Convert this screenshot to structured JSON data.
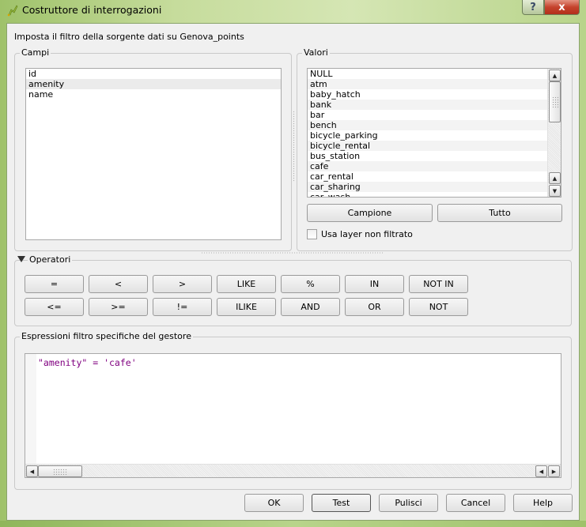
{
  "window": {
    "title": "Costruttore di interrogazioni",
    "help_button": "?",
    "close_button": "x"
  },
  "subtitle": "Imposta il filtro della sorgente dati su Genova_points",
  "campi": {
    "label": "Campi",
    "items": [
      "id",
      "amenity",
      "name"
    ],
    "selected": "amenity"
  },
  "valori": {
    "label": "Valori",
    "items": [
      "NULL",
      "atm",
      "baby_hatch",
      "bank",
      "bar",
      "bench",
      "bicycle_parking",
      "bicycle_rental",
      "bus_station",
      "cafe",
      "car_rental",
      "car_sharing",
      "car_wash"
    ],
    "sample_button": "Campione",
    "all_button": "Tutto",
    "unfiltered_checkbox_label": "Usa layer non filtrato",
    "unfiltered_checked": false
  },
  "operatori": {
    "label": "Operatori",
    "expanded": true,
    "row1": [
      "=",
      "<",
      ">",
      "LIKE",
      "%",
      "IN",
      "NOT IN"
    ],
    "row2": [
      "<=",
      ">=",
      "!=",
      "ILIKE",
      "AND",
      "OR",
      "NOT"
    ]
  },
  "espressione": {
    "label": "Espressioni filtro specifiche del gestore",
    "value": "\"amenity\" = 'cafe'",
    "text_color": "#800080"
  },
  "footer": {
    "ok": "OK",
    "test": "Test",
    "clear": "Pulisci",
    "cancel": "Cancel",
    "help": "Help"
  }
}
